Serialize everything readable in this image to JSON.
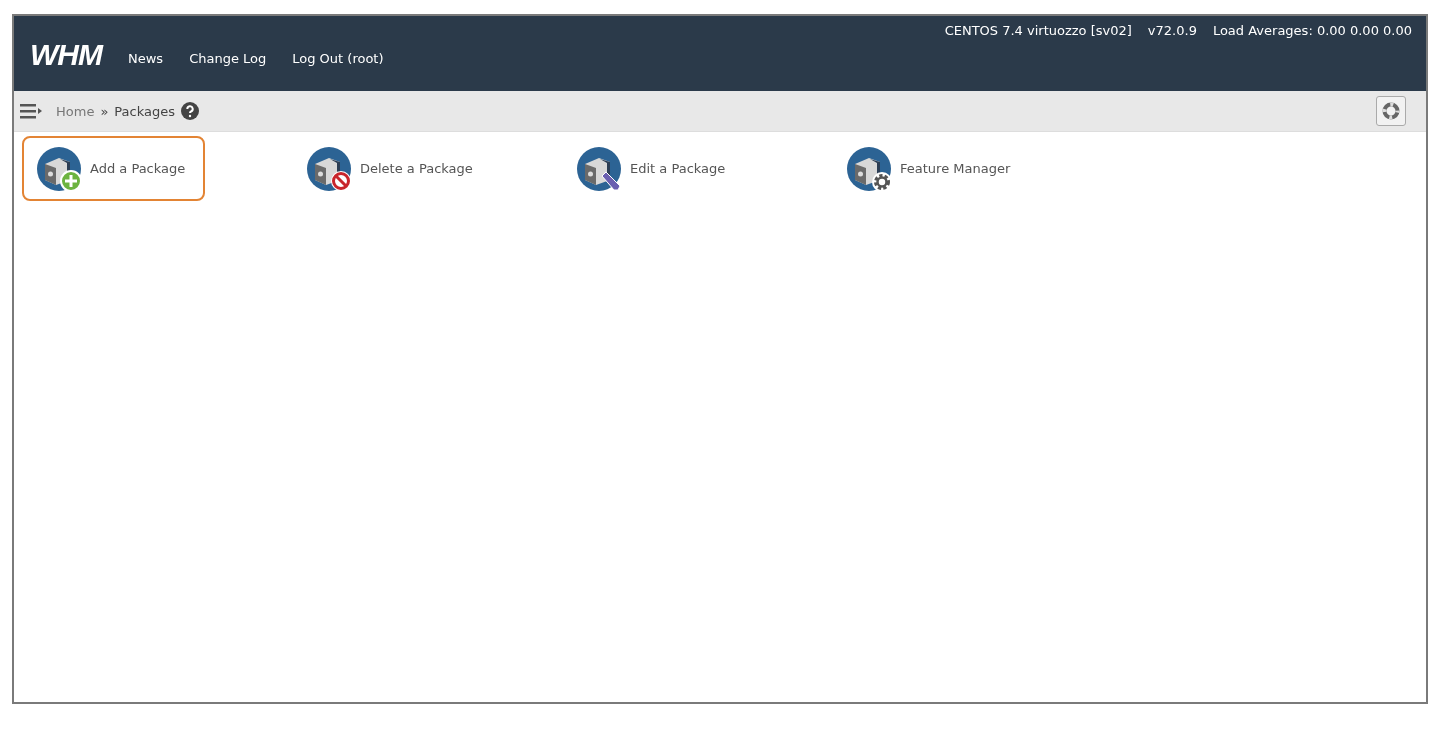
{
  "header": {
    "logo": "WHM",
    "nav": [
      "News",
      "Change Log",
      "Log Out (root)"
    ],
    "server_info": [
      "CENTOS 7.4 virtuozzo [sv02]",
      "v72.0.9",
      "Load Averages: 0.00 0.00 0.00"
    ]
  },
  "breadcrumb": {
    "home": "Home",
    "separator": "»",
    "current": "Packages"
  },
  "items": [
    {
      "label": "Add a Package",
      "kind": "add",
      "selected": true
    },
    {
      "label": "Delete a Package",
      "kind": "delete",
      "selected": false
    },
    {
      "label": "Edit a Package",
      "kind": "edit",
      "selected": false
    },
    {
      "label": "Feature Manager",
      "kind": "feature",
      "selected": false
    }
  ]
}
